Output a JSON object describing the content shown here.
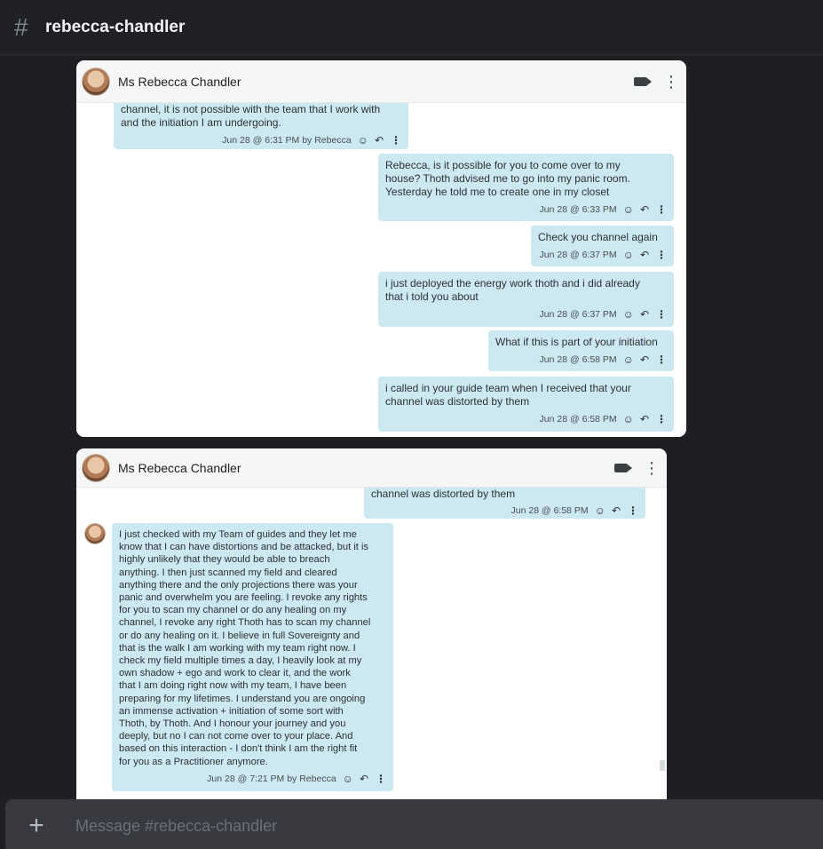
{
  "channel": {
    "hash": "#",
    "name": "rebecca-chandler",
    "composer_placeholder": "Message #rebecca-chandler"
  },
  "shot1": {
    "contact": "Ms Rebecca Chandler",
    "messages": [
      {
        "text": "channel, it is not possible with the team that I work with\nand the initiation I am undergoing.",
        "meta": "Jun 28 @ 6:31 PM by Rebecca"
      },
      {
        "text": "Rebecca, is it possible for you to come over to my\nhouse?  Thoth advised me to go into my panic room.\n Yesterday he told me to create one in my closet",
        "meta": "Jun 28 @ 6:33 PM"
      },
      {
        "text": "Check you channel again",
        "meta": "Jun 28 @ 6:37 PM"
      },
      {
        "text": "i just deployed the energy work thoth and i did already\nthat i told you about",
        "meta": "Jun 28 @ 6:37 PM"
      },
      {
        "text": "What if this is part of your initiation",
        "meta": "Jun 28 @ 6:58 PM"
      },
      {
        "text": "i called in your guide team when I received that your\nchannel was distorted by them",
        "meta": "Jun 28 @ 6:58 PM"
      }
    ]
  },
  "shot2": {
    "contact": "Ms Rebecca Chandler",
    "messages": [
      {
        "text": "channel was distorted by them",
        "meta": "Jun 28 @ 6:58 PM"
      },
      {
        "text": "I just checked with my Team of guides and they let me\nknow that I can have distortions and be attacked, but it is\nhighly unlikely that they would be able to breach\nanything. I then just scanned my field and cleared\nanything there and the only projections there was your\npanic and overwhelm you are feeling. I revoke any rights\nfor you to scan my channel or do any healing on my\nchannel, I revoke any right Thoth has to scan my channel\nor do any healing on it. I believe in full Sovereignty and\nthat is the walk I am working with my team right now. I\ncheck my field multiple times a day, I heavily look at my\nown shadow + ego and work to clear it, and the work\nthat I am doing right now with my team, I have been\npreparing for my lifetimes. I understand you are ongoing\nan immense activation + initiation of some sort with\nThoth, by Thoth. And I honour your journey and you\ndeeply, but no I can not come over to your place. And\nbased on this interaction - I don't think I am the right fit\nfor you as a Practitioner anymore.",
        "meta": "Jun 28 @ 7:21 PM by Rebecca"
      }
    ]
  },
  "icons": {
    "emoji": "☺",
    "reply": "↶",
    "more": "⋮"
  }
}
